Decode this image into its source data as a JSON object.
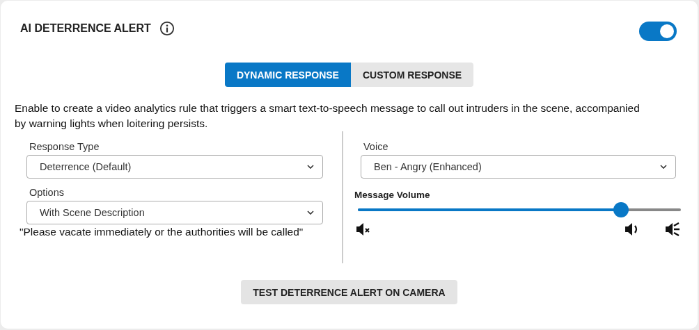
{
  "title": "AI DETERRENCE ALERT",
  "enabled": {
    "on": true
  },
  "tabs": [
    {
      "label": "DYNAMIC RESPONSE",
      "selected": true
    },
    {
      "label": "CUSTOM RESPONSE",
      "selected": false
    }
  ],
  "description": "Enable to create a video analytics rule that triggers a smart text-to-speech message to call out intruders in the scene, accompanied by warning lights when loitering persists.",
  "left_fields": [
    {
      "label": "Response Type",
      "value": "Deterrence (Default)"
    },
    {
      "label": "Options",
      "value": "With Scene Description"
    }
  ],
  "sample_message": "\"Please vacate immediately or the authorities will be called\"",
  "voice": {
    "label": "Voice",
    "value": "Ben - Angry (Enhanced)"
  },
  "volume": {
    "label": "Message Volume",
    "level": 0.83
  },
  "test_button": "TEST DETERRENCE ALERT ON CAMERA"
}
